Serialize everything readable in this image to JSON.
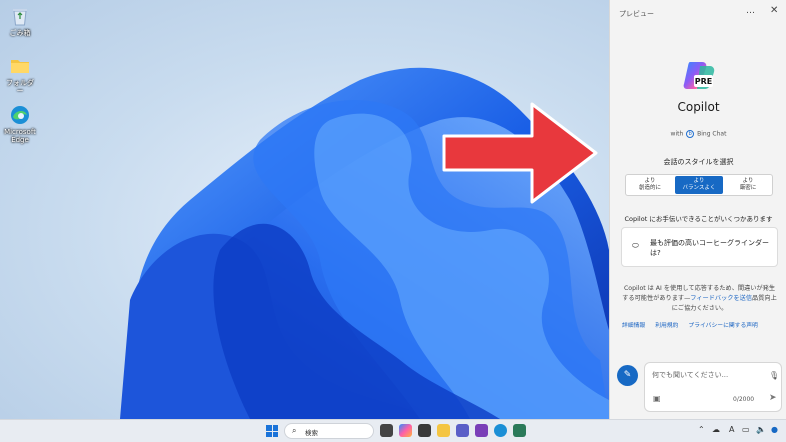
{
  "desktop": {
    "icons": [
      {
        "label": "ごみ箱",
        "icon": "recycle-bin-icon"
      },
      {
        "label": "フォルダー",
        "icon": "folder-icon"
      },
      {
        "label": "Microsoft Edge",
        "icon": "edge-icon"
      }
    ]
  },
  "panel": {
    "title": "プレビュー",
    "more": "…",
    "close": "✕",
    "logo_badge": "PRE",
    "name": "Copilot",
    "with_prefix": "with",
    "with_badge": "b",
    "with_suffix": "Bing Chat",
    "style_title": "会話のスタイルを選択",
    "styles": [
      {
        "line1": "より",
        "line2": "創造的に"
      },
      {
        "line1": "より",
        "line2": "バランスよく"
      },
      {
        "line1": "より",
        "line2": "厳密に"
      }
    ],
    "hint": "Copilot にお手伝いできることがいくつかあります",
    "suggestion": "最も評価の高いコーヒーグラインダーは?",
    "disclaimer_text": "Copilot は AI を使用して応答するため、間違いが発生する可能性があります—",
    "disclaimer_link": "フィードバックを送信",
    "disclaimer_end": "品質向上にご協力ください。",
    "links": [
      "詳細情報",
      "利用規約",
      "プライバシーに関する声明"
    ],
    "input_placeholder": "何でも聞いてください...",
    "counter": "0/2000"
  },
  "taskbar": {
    "search_label": "検索",
    "tray_ime": "A"
  },
  "colors": {
    "accent": "#1769c4",
    "arrow": "#e8383d",
    "bloom": "#1c64e6"
  }
}
